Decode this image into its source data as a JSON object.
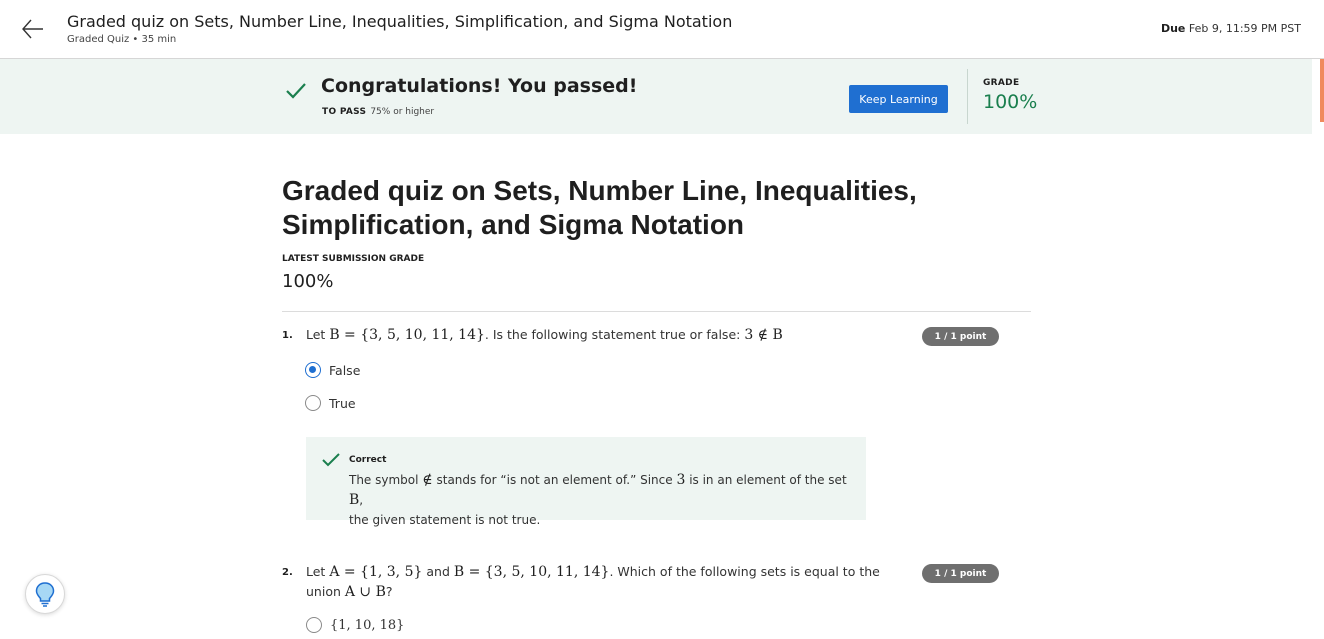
{
  "header": {
    "title": "Graded quiz on Sets, Number Line, Inequalities, Simplification, and Sigma Notation",
    "subtitle": "Graded Quiz • 35 min",
    "due_label": "Due",
    "due_value": "Feb 9, 11:59 PM PST"
  },
  "banner": {
    "message": "Congratulations! You passed!",
    "to_pass_label": "TO PASS",
    "to_pass_value": "75% or higher",
    "button_label": "Keep Learning",
    "grade_label": "GRADE",
    "grade_value": "100%",
    "accent_color": "#1a7f4e"
  },
  "main": {
    "title": "Graded quiz on Sets, Number Line, Inequalities, Simplification, and Sigma Notation",
    "latest_label": "LATEST SUBMISSION GRADE",
    "latest_value": "100%"
  },
  "questions": [
    {
      "number": "1.",
      "text_parts": [
        "Let ",
        "B = {3, 5, 10, 11, 14}",
        ". Is the following statement true or false: ",
        "3 ∉ B"
      ],
      "points": "1 / 1 point",
      "options": [
        {
          "label": "False",
          "selected": true
        },
        {
          "label": "True",
          "selected": false
        }
      ],
      "feedback": {
        "label": "Correct",
        "text_parts": [
          "The symbol ",
          "∉",
          " stands for “is not an element of.” Since ",
          "3",
          " is in an element of the set ",
          "B",
          ",",
          "the given statement is not true."
        ]
      }
    },
    {
      "number": "2.",
      "text_parts": [
        "Let ",
        "A = {1, 3, 5}",
        " and ",
        "B = {3, 5, 10, 11, 14}",
        ". Which of the following sets is equal to the",
        "union ",
        "A ∪ B",
        "?"
      ],
      "points": "1 / 1 point",
      "partial_option": "{1, 10, 18}"
    }
  ],
  "icons": {
    "back": "back-arrow-icon",
    "check": "checkmark-icon",
    "lightbulb": "lightbulb-icon"
  }
}
